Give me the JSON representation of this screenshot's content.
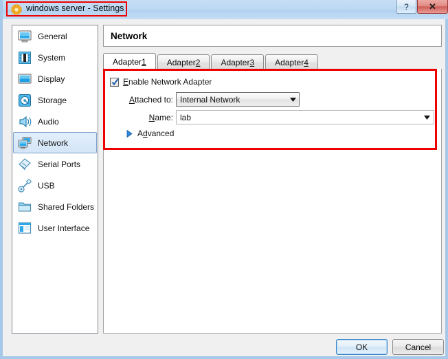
{
  "window": {
    "title": "windows server - Settings",
    "app_icon": "virtualbox-icon",
    "help_label": "?",
    "close_label": "✕",
    "background_blur_line1": "",
    "background_blur_line2": ""
  },
  "sidebar": {
    "items": [
      {
        "label": "General",
        "icon": "monitor-icon",
        "selected": false
      },
      {
        "label": "System",
        "icon": "chip-icon",
        "selected": false
      },
      {
        "label": "Display",
        "icon": "display-icon",
        "selected": false
      },
      {
        "label": "Storage",
        "icon": "harddisk-icon",
        "selected": false
      },
      {
        "label": "Audio",
        "icon": "speaker-icon",
        "selected": false
      },
      {
        "label": "Network",
        "icon": "network-icon",
        "selected": true
      },
      {
        "label": "Serial Ports",
        "icon": "serial-port-icon",
        "selected": false
      },
      {
        "label": "USB",
        "icon": "usb-icon",
        "selected": false
      },
      {
        "label": "Shared Folders",
        "icon": "folder-icon",
        "selected": false
      },
      {
        "label": "User Interface",
        "icon": "user-interface-icon",
        "selected": false
      }
    ]
  },
  "panel": {
    "title": "Network",
    "tabs": [
      {
        "label": "Adapter ",
        "accel": "1",
        "active": true
      },
      {
        "label": "Adapter ",
        "accel": "2",
        "active": false
      },
      {
        "label": "Adapter ",
        "accel": "3",
        "active": false
      },
      {
        "label": "Adapter ",
        "accel": "4",
        "active": false
      }
    ],
    "enable_adapter": {
      "label_pre": "",
      "label_accel": "E",
      "label_post": "nable Network Adapter",
      "checked": true
    },
    "attached_to": {
      "label_accel": "A",
      "label_pre": "",
      "label_post": "ttached to:",
      "value": "Internal Network"
    },
    "name": {
      "label_accel": "N",
      "label_post": "ame:",
      "value": "lab"
    },
    "advanced": {
      "label_pre": "A",
      "label_accel": "d",
      "label_post": "vanced",
      "expanded": false
    }
  },
  "footer": {
    "ok_label": "OK",
    "cancel_label": "Cancel"
  },
  "annotations": {
    "title_box_color": "#ee0000",
    "content_box_color": "#ee0000"
  }
}
